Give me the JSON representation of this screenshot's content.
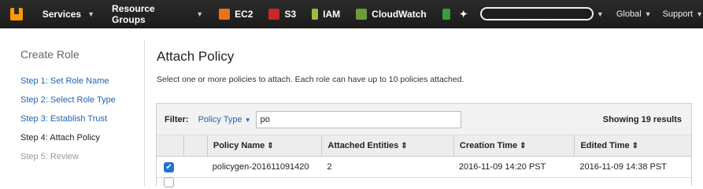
{
  "topbar": {
    "services_label": "Services",
    "resource_groups_label": "Resource Groups",
    "shortcuts": [
      {
        "label": "EC2",
        "icon": "ec2-icon",
        "color": "#e8731a"
      },
      {
        "label": "S3",
        "icon": "s3-icon",
        "color": "#c7282a"
      },
      {
        "label": "IAM",
        "icon": "iam-icon",
        "color": "#9bbf3a"
      },
      {
        "label": "CloudWatch",
        "icon": "cloudwatch-icon",
        "color": "#6d9b3a"
      }
    ],
    "region_label": "Global",
    "support_label": "Support"
  },
  "sidebar": {
    "title": "Create Role",
    "steps": [
      {
        "label": "Step 1: Set Role Name",
        "state": "link"
      },
      {
        "label": "Step 2: Select Role Type",
        "state": "link"
      },
      {
        "label": "Step 3: Establish Trust",
        "state": "link"
      },
      {
        "label": "Step 4: Attach Policy",
        "state": "current"
      },
      {
        "label": "Step 5: Review",
        "state": "disabled"
      }
    ]
  },
  "main": {
    "title": "Attach Policy",
    "description": "Select one or more policies to attach. Each role can have up to 10 policies attached."
  },
  "filter": {
    "label": "Filter:",
    "policy_type_label": "Policy Type",
    "query": "po",
    "showing": "Showing 19 results"
  },
  "table": {
    "columns": [
      "Policy Name",
      "Attached Entities",
      "Creation Time",
      "Edited Time"
    ],
    "rows": [
      {
        "checked": true,
        "name": "policygen-201611091420",
        "attached": "2",
        "created": "2016-11-09 14:20 PST",
        "edited": "2016-11-09 14:38 PST"
      }
    ]
  },
  "colors": {
    "accent": "#1f73d8",
    "link": "#1f62b5",
    "nav_bg": "#232323"
  }
}
